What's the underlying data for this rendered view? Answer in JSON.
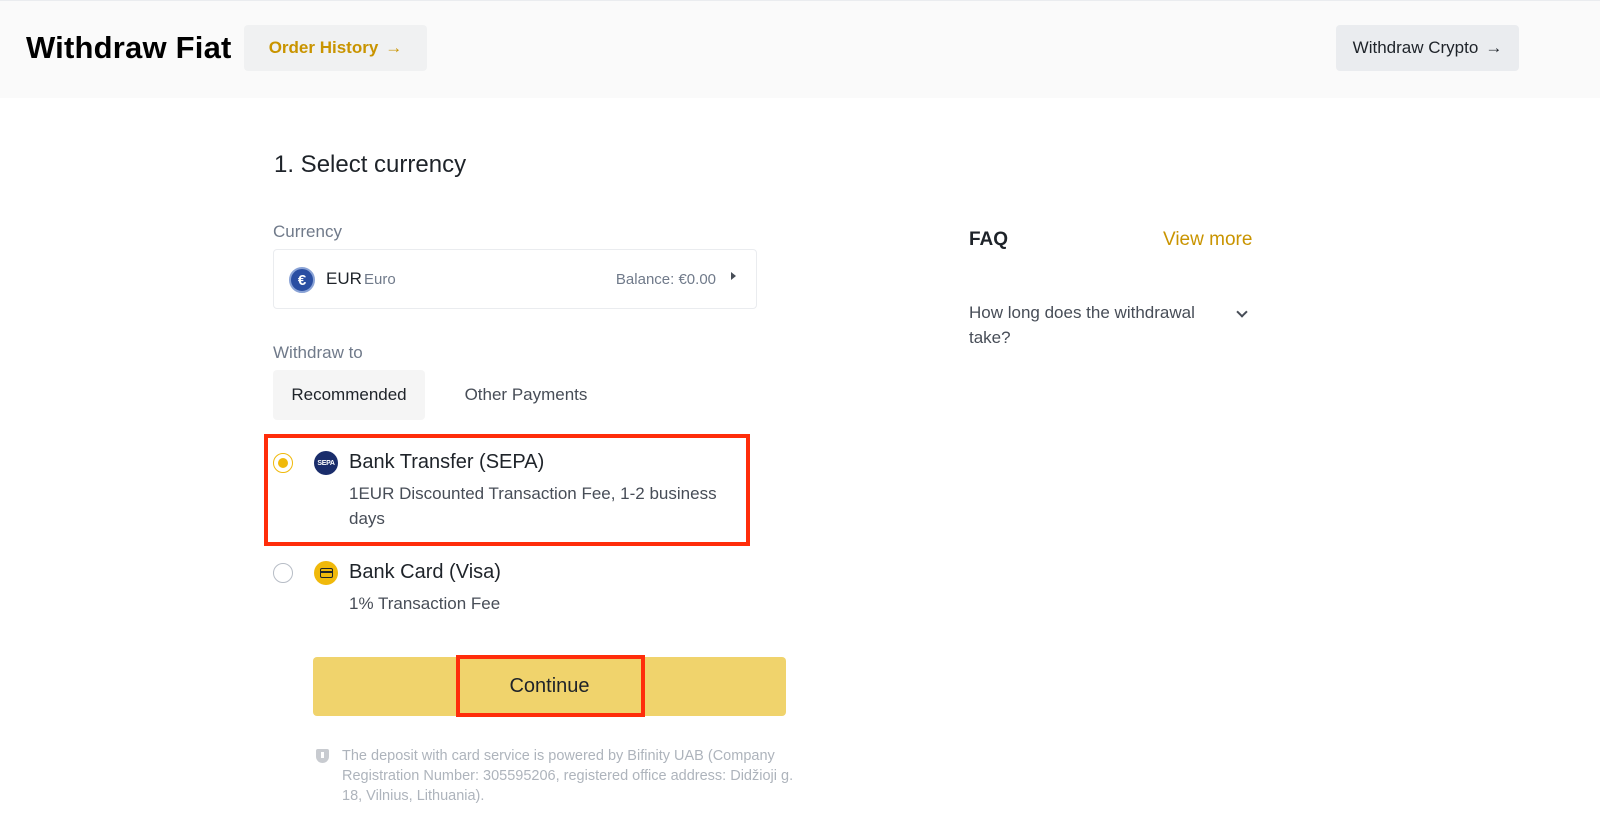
{
  "header": {
    "title": "Withdraw Fiat",
    "order_history_label": "Order History",
    "withdraw_crypto_label": "Withdraw Crypto",
    "arrow_glyph": "→"
  },
  "main": {
    "section_title": "1. Select currency",
    "currency_label": "Currency",
    "currency": {
      "symbol": "€",
      "code": "EUR",
      "name": "Euro",
      "balance": "Balance: €0.00"
    },
    "withdraw_to_label": "Withdraw to",
    "tabs": [
      {
        "label": "Recommended",
        "active": true
      },
      {
        "label": "Other Payments",
        "active": false
      }
    ],
    "options": [
      {
        "icon": "sepa-icon",
        "icon_text": "SEPA",
        "title": "Bank Transfer (SEPA)",
        "description": "1EUR Discounted Transaction Fee, 1-2 business days",
        "selected": true
      },
      {
        "icon": "bank-card-icon",
        "title": "Bank Card (Visa)",
        "description": "1% Transaction Fee",
        "selected": false
      }
    ],
    "continue_label": "Continue",
    "disclaimer": "The deposit with card service is powered by Bifinity UAB (Company Registration Number: 305595206, registered office address: Didžioji g. 18, Vilnius, Lithuania)."
  },
  "faq": {
    "title": "FAQ",
    "view_more_label": "View more",
    "questions": [
      "How long does the withdrawal take?"
    ]
  },
  "colors": {
    "accent": "#f0b90b",
    "link": "#c99400",
    "highlight": "#ff2d0a"
  }
}
